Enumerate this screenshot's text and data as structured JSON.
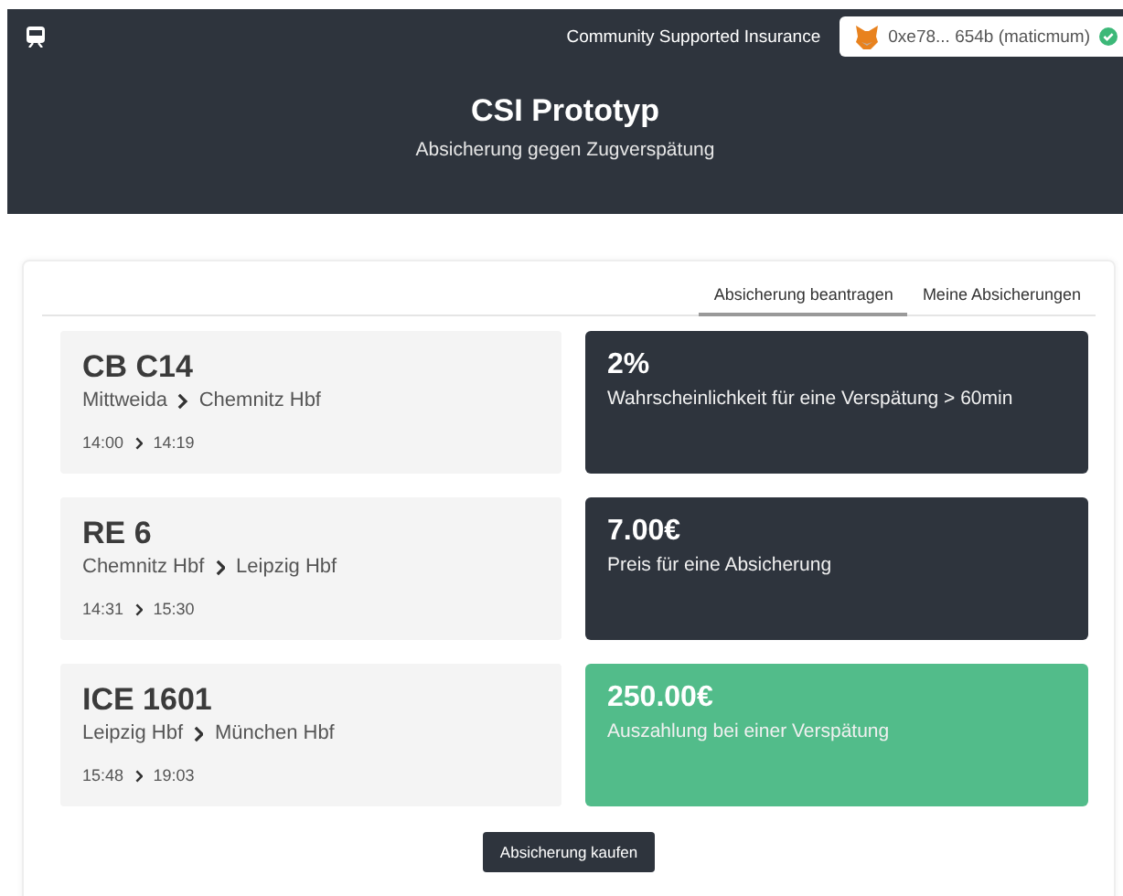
{
  "header": {
    "brand": "Community Supported Insurance",
    "wallet": {
      "address": "0xe78... 654b (maticmum)",
      "connected": true
    },
    "title": "CSI Prototyp",
    "subtitle": "Absicherung gegen Zugverspätung"
  },
  "tabs": [
    {
      "label": "Absicherung beantragen",
      "selected": true
    },
    {
      "label": "Meine Absicherungen",
      "selected": false
    }
  ],
  "trains": [
    {
      "name": "CB C14",
      "from": "Mittweida",
      "to": "Chemnitz Hbf",
      "departure": "14:00",
      "arrival": "14:19"
    },
    {
      "name": "RE 6",
      "from": "Chemnitz Hbf",
      "to": "Leipzig Hbf",
      "departure": "14:31",
      "arrival": "15:30"
    },
    {
      "name": "ICE 1601",
      "from": "Leipzig Hbf",
      "to": "München Hbf",
      "departure": "15:48",
      "arrival": "19:03"
    }
  ],
  "stats": [
    {
      "value": "2%",
      "label": "Wahrscheinlichkeit für eine Verspätung > 60min",
      "kind": "dark"
    },
    {
      "value": "7.00€",
      "label": "Preis für eine Absicherung",
      "kind": "dark"
    },
    {
      "value": "250.00€",
      "label": "Auszahlung bei einer Verspätung",
      "kind": "success"
    }
  ],
  "button": "Absicherung kaufen"
}
